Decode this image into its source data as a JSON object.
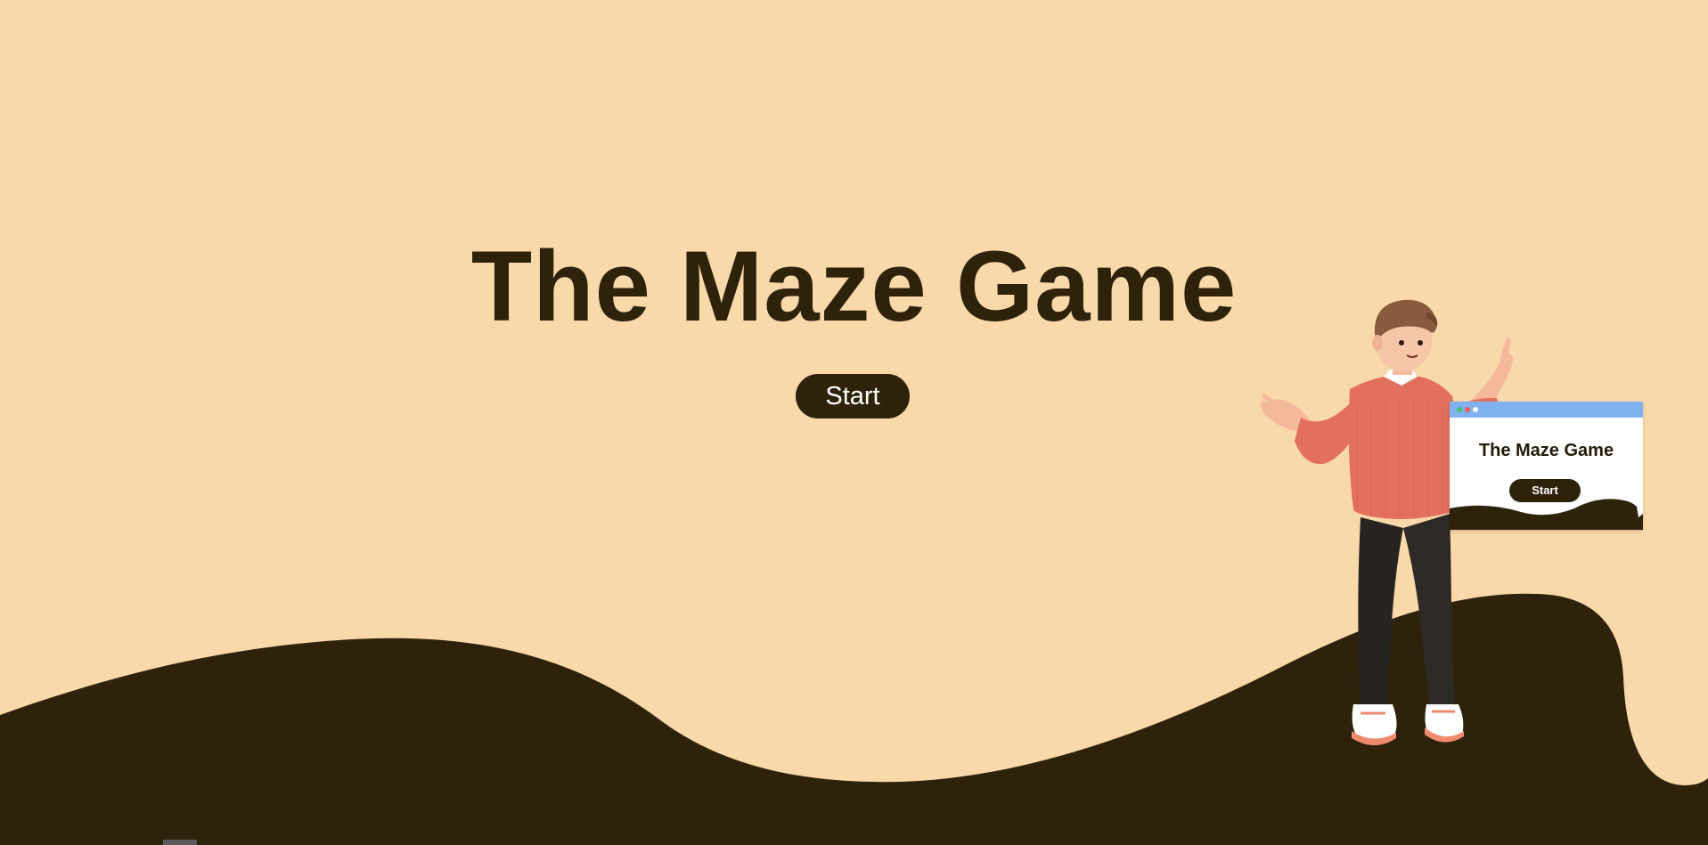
{
  "page": {
    "title": "The Maze Game",
    "start_label": "Start"
  },
  "illustration": {
    "window_title": "The Maze Game",
    "window_start_label": "Start"
  },
  "colors": {
    "background": "#f9d8a9",
    "wave": "#2e220b",
    "button": "#2e220b",
    "button_text": "#ffffff",
    "title_text": "#2e220b"
  }
}
